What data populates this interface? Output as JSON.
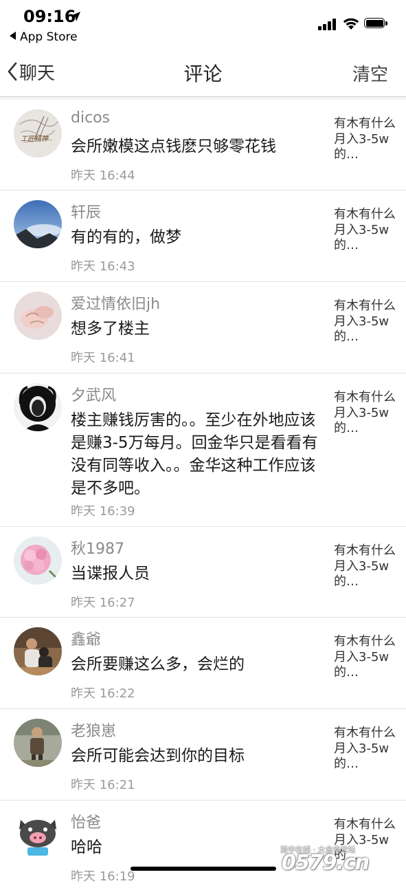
{
  "status_bar": {
    "time": "09:16",
    "back_app": "App Store"
  },
  "nav": {
    "back_label": "聊天",
    "title": "评论",
    "clear_label": "清空"
  },
  "comments": [
    {
      "avatar": "pencil-sketch-avatar",
      "username": "dicos",
      "text": "会所嫩模这点钱麽只够零花钱",
      "time": "昨天 16:44",
      "quote": "有木有什么月入3-5w的…"
    },
    {
      "avatar": "sky-landscape-avatar",
      "username": "轩辰",
      "text": "有的有的，做梦",
      "time": "昨天 16:43",
      "quote": "有木有什么月入3-5w的…"
    },
    {
      "avatar": "hands-avatar",
      "username": "爱过情依旧jh",
      "text": "想多了楼主",
      "time": "昨天 16:41",
      "quote": "有木有什么月入3-5w的…"
    },
    {
      "avatar": "portrait-silhouette-avatar",
      "username": "夕武风",
      "text": "楼主赚钱厉害的。。至少在外地应该是赚3-5万每月。回金华只是看看有没有同等收入。。金华这种工作应该是不多吧。",
      "time": "昨天 16:39",
      "quote": "有木有什么月入3-5w的…"
    },
    {
      "avatar": "pink-flower-avatar",
      "username": "秋1987",
      "text": "当谍报人员",
      "time": "昨天 16:27",
      "quote": "有木有什么月入3-5w的…"
    },
    {
      "avatar": "man-with-child-avatar",
      "username": "鑫爺",
      "text": "会所要赚这么多，会烂的",
      "time": "昨天 16:22",
      "quote": "有木有什么月入3-5w的…"
    },
    {
      "avatar": "child-photo-avatar",
      "username": "老狼崽",
      "text": "会所可能会达到你的目标",
      "time": "昨天 16:21",
      "quote": "有木有什么月入3-5w的…"
    },
    {
      "avatar": "cartoon-pig-avatar",
      "username": "怡爸",
      "text": "哈哈",
      "time": "昨天 16:19",
      "quote": "有木有什么月入3-5w的…"
    }
  ],
  "watermark": {
    "line1": "浙中在线 · 大金华论坛",
    "line2": "0579.cn"
  }
}
